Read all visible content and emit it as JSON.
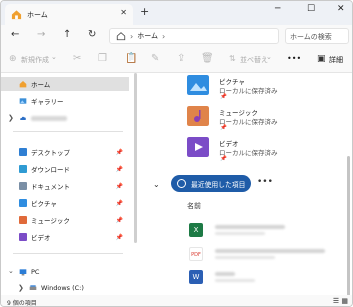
{
  "tab": {
    "title": "ホーム",
    "close": "✕",
    "new_tab": "+"
  },
  "window_controls": {
    "minimize": "─",
    "maximize": "☐",
    "close": "✕"
  },
  "nav": {
    "back": "←",
    "forward": "→",
    "up": "↑",
    "refresh": "↻",
    "expand": "❯"
  },
  "address": {
    "crumb": "ホーム",
    "sep": "›",
    "search_placeholder": "ホームの検索"
  },
  "commands": {
    "new": "新規作成",
    "new_chevron": "⌄",
    "sort": "並べ替え",
    "sort_chevron": "⌄",
    "more": "•••",
    "details": "詳細"
  },
  "sidebar": {
    "home": "ホーム",
    "gallery": "ギャラリー",
    "quick": [
      {
        "label": "デスクトップ",
        "icon": "desktop-icon",
        "color": "#2f7fd3"
      },
      {
        "label": "ダウンロード",
        "icon": "download-icon",
        "color": "#2f9bd3"
      },
      {
        "label": "ドキュメント",
        "icon": "documents-icon",
        "color": "#7a8fa6"
      },
      {
        "label": "ピクチャ",
        "icon": "pictures-icon",
        "color": "#2f8de0"
      },
      {
        "label": "ミュージック",
        "icon": "music-icon",
        "color": "#e06a3a"
      },
      {
        "label": "ビデオ",
        "icon": "videos-icon",
        "color": "#7b4cc7"
      }
    ],
    "pc": "PC",
    "drive": "Windows (C:)",
    "pin_glyph": "📌"
  },
  "libraries": [
    {
      "name": "ピクチャ",
      "sub": "ローカルに保存済み",
      "icon": "pictures-folder-icon",
      "color": "#2f8de0"
    },
    {
      "name": "ミュージック",
      "sub": "ローカルに保存済み",
      "icon": "music-folder-icon",
      "color": "#e0844a"
    },
    {
      "name": "ビデオ",
      "sub": "ローカルに保存済み",
      "icon": "videos-folder-icon",
      "color": "#7b4cc7"
    }
  ],
  "recent": {
    "label": "最近使用した項目",
    "more": "•••",
    "chevron": "⌄",
    "column_name": "名前"
  },
  "files": [
    {
      "icon": "excel-file-icon",
      "color": "#1d7a45",
      "badge": "X"
    },
    {
      "icon": "pdf-file-icon",
      "color": "#d93a2f",
      "badge": "PDF"
    },
    {
      "icon": "word-file-icon",
      "color": "#2b5fb4",
      "badge": "W"
    }
  ],
  "status": {
    "count": "9 個の項目"
  }
}
